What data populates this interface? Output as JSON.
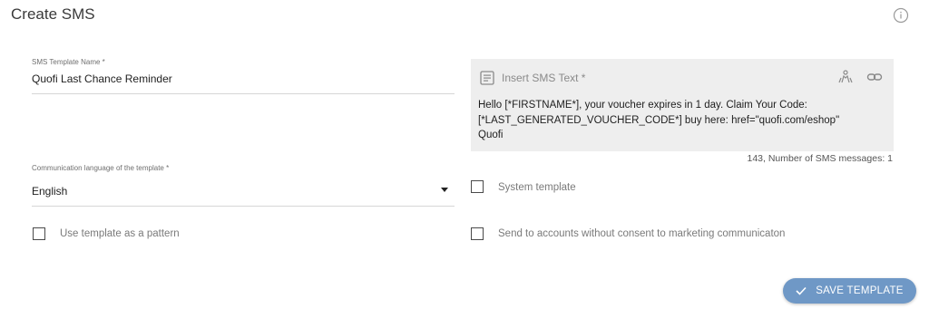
{
  "header": {
    "title": "Create SMS"
  },
  "form": {
    "template_name": {
      "label": "SMS Template Name *",
      "value": "Quofi Last Chance Reminder"
    },
    "language": {
      "label": "Communication language of the template *",
      "selected": "English"
    },
    "use_as_pattern": {
      "label": "Use template as a pattern",
      "checked": false
    },
    "system_template": {
      "label": "System template",
      "checked": false
    },
    "send_without_consent": {
      "label": "Send to accounts without consent to marketing communicaton",
      "checked": false
    }
  },
  "sms_editor": {
    "header_label": "Insert SMS Text *",
    "lines": [
      "Hello [*FIRSTNAME*], your voucher expires in 1 day. Claim Your Code:",
      "[*LAST_GENERATED_VOUCHER_CODE*] buy here: href=\"quofi.com/eshop\"",
      "Quofi"
    ],
    "counter": "143, Number of SMS messages: 1",
    "icons": [
      "text-template-icon",
      "personalization-icon",
      "link-icon"
    ]
  },
  "actions": {
    "save_label": "SAVE TEMPLATE"
  },
  "colors": {
    "primary_button": "#6f98c6",
    "editor_background": "#eeeeee"
  }
}
